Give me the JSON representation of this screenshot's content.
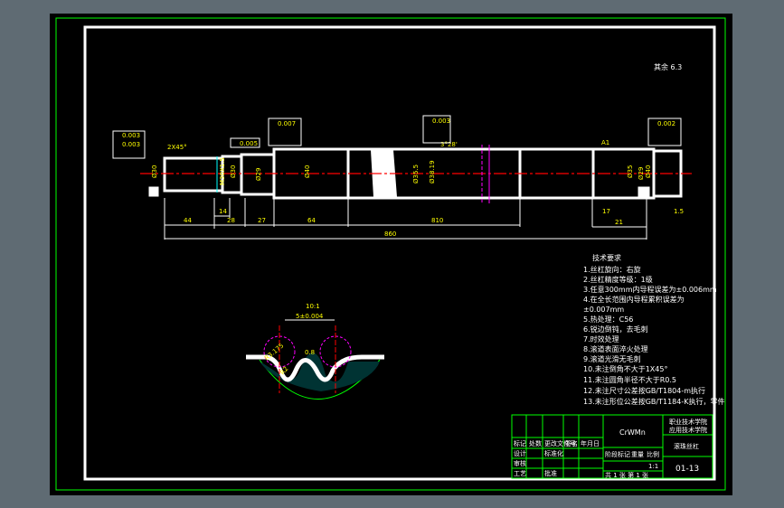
{
  "colors": {
    "frame": "#ffffff",
    "border": "#00ff00",
    "centerline": "#ff0000",
    "dims": "#ffff00",
    "section": "#ff00ff",
    "hatch": "#00ffff"
  },
  "drawing": {
    "roughness_note": "其余 6.3",
    "chamfer_left": "2X45°",
    "angle": "3°28'",
    "datum": "A1",
    "dims": {
      "d44": "44",
      "d28": "28",
      "d14": "14",
      "d27": "27",
      "d64": "64",
      "d810": "810",
      "d17": "17",
      "d21": "21",
      "d860": "860",
      "d15": "1.5"
    },
    "diameters": [
      "Ø30",
      "M30X1.5",
      "Ø30",
      "Ø29",
      "Ø40",
      "Ø35.5",
      "Ø38.19",
      "Ø35",
      "Ø29",
      "Ø40"
    ],
    "gtol": {
      "t1": "0.003",
      "t2": "0.003",
      "t3": "0.005",
      "t4": "0.007",
      "t5": "0.003",
      "t6": "0.002"
    },
    "section": {
      "title": "10:1",
      "pitch": "5±0.004",
      "radius": "R3.175",
      "r2": "R2",
      "r3": "0.8"
    }
  },
  "tech": {
    "title": "技术要求",
    "items": [
      "1.丝杠旋向：右旋",
      "2.丝杠精度等级：1级",
      "3.任意300mm内导程误差为±0.006mm",
      "4.在全长范围内导程累积误差为",
      "±0.007mm",
      "5.热处理：C56",
      "6.锐边倒钝，去毛刺",
      "7.时效处理",
      "8.滚道表面淬火处理",
      "9.滚道光滑无毛刺",
      "10.未注倒角不大于1X45°",
      "11.未注圆角半径不大于R0.5",
      "12.未注尺寸公差按GB/T1804-m执行",
      "13.未注形位公差按GB/T1184-K执行，零件"
    ]
  },
  "title_block": {
    "material": "CrWMn",
    "school_1": "职业技术学院",
    "school_2": "应用技术学院",
    "part_name": "滚珠丝杠",
    "drawing_no": "01-13",
    "scale": "1:1",
    "labels": {
      "mark": "标记",
      "count": "处数",
      "zone": "分区",
      "doc": "更改文件号",
      "sign": "签名",
      "date": "年月日",
      "design": "设计",
      "std": "标准化",
      "check": "审核",
      "craft": "工艺",
      "approve": "批准",
      "stage": "阶段标记",
      "weight": "重量",
      "ratio": "比例",
      "sheets": "共 1 张 第 1 张"
    }
  }
}
